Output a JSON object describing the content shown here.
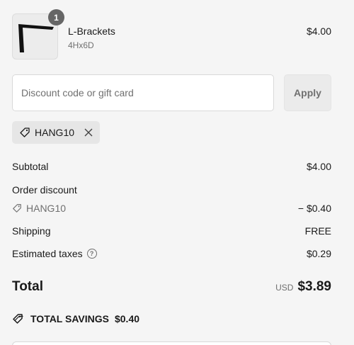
{
  "product": {
    "quantity": "1",
    "name": "L-Brackets",
    "variant": "4Hx6D",
    "price": "$4.00"
  },
  "discount": {
    "placeholder": "Discount code or gift card",
    "apply_label": "Apply",
    "applied_code": "HANG10"
  },
  "summary": {
    "subtotal_label": "Subtotal",
    "subtotal_value": "$4.00",
    "order_discount_label": "Order discount",
    "discount_code": "HANG10",
    "discount_value": "− $0.40",
    "shipping_label": "Shipping",
    "shipping_value": "FREE",
    "taxes_label": "Estimated taxes",
    "taxes_value": "$0.29",
    "total_label": "Total",
    "currency": "USD",
    "total_value": "$3.89",
    "savings_label": "TOTAL SAVINGS",
    "savings_value": "$0.40"
  },
  "icons": {
    "tag": "tag-icon",
    "close": "close-icon",
    "help": "help-circle-icon",
    "savings": "savings-tag-icon"
  },
  "colors": {
    "background": "#f5f5f5",
    "text": "#1a1a1a",
    "muted": "#707070",
    "badge": "#666666"
  }
}
